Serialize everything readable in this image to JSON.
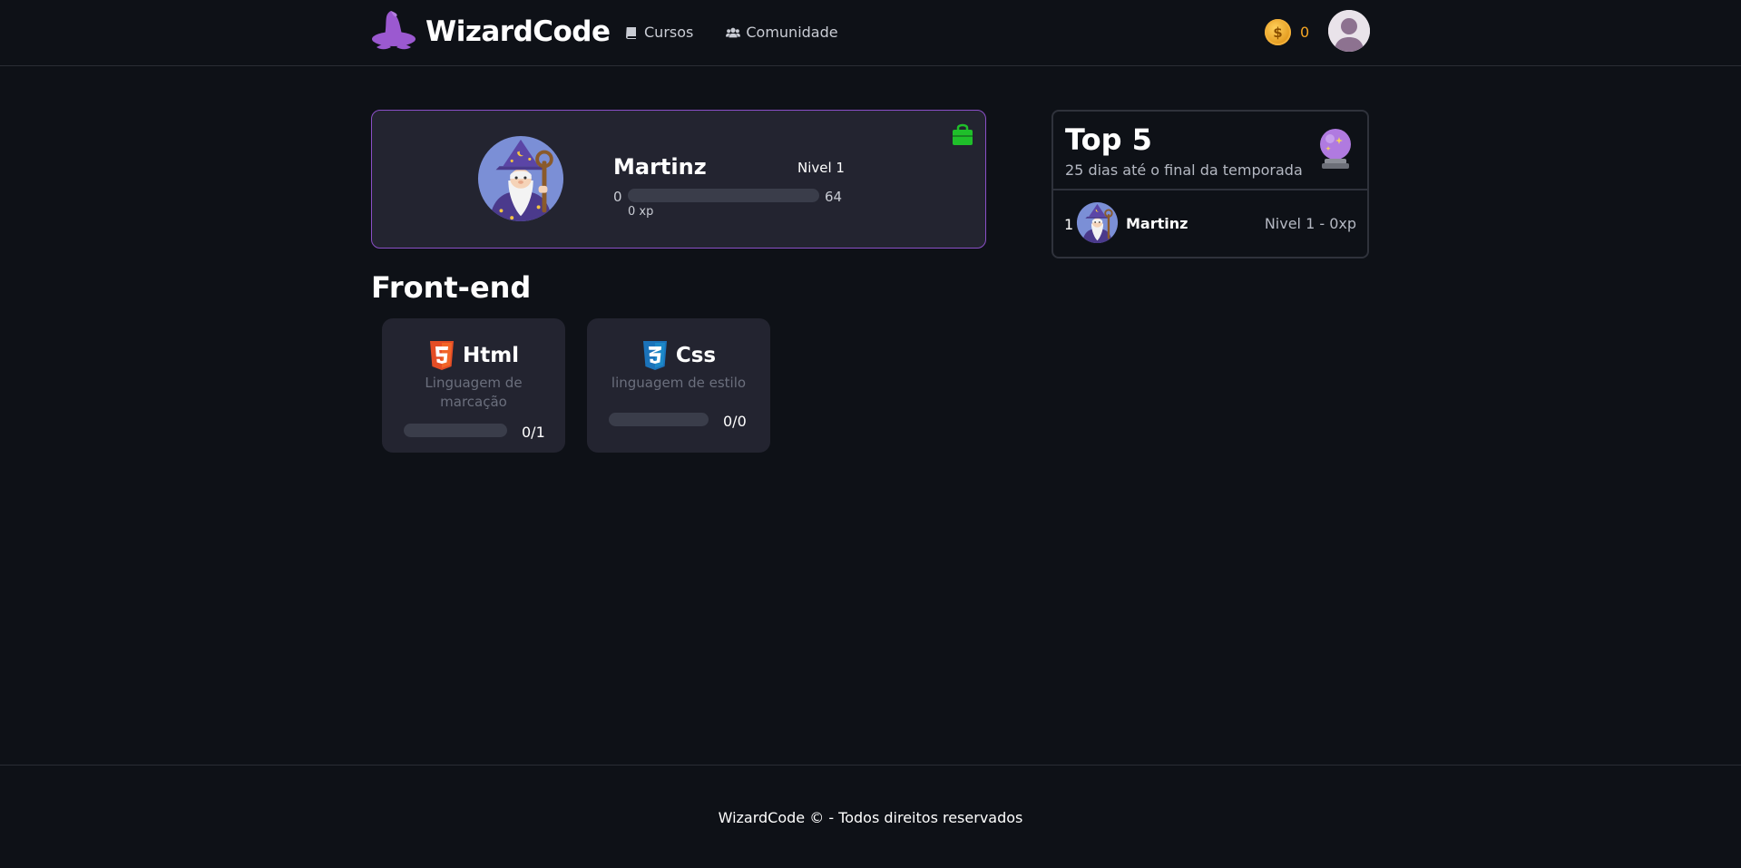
{
  "header": {
    "brand": "WizardCode",
    "nav": [
      {
        "label": "Cursos",
        "icon": "book-icon"
      },
      {
        "label": "Comunidade",
        "icon": "users-icon"
      }
    ],
    "coins": "0"
  },
  "profile": {
    "name": "Martinz",
    "level": "Nivel 1",
    "xp_min": "0",
    "xp_max": "64",
    "xp_text": "0 xp",
    "xp_progress": 0
  },
  "section": {
    "title": "Front-end"
  },
  "courses": [
    {
      "name": "Html",
      "description": "Linguagem de marcação",
      "progress": "0/1",
      "fraction": 0,
      "icon": "html5-icon"
    },
    {
      "name": "Css",
      "description": "linguagem de estilo",
      "progress": "0/0",
      "fraction": 0,
      "icon": "css3-icon"
    }
  ],
  "leaderboard": {
    "title": "Top 5",
    "subtitle": "25 dias até o final da temporada",
    "entries": [
      {
        "rank": "1",
        "name": "Martinz",
        "level": "Nivel 1 - 0xp"
      }
    ]
  },
  "footer": {
    "text": "WizardCode © - Todos direitos reservados"
  },
  "colors": {
    "background": "#0e1117",
    "card": "#232430",
    "accent": "#8a4fc7",
    "coin": "#f5a623",
    "bag": "#1fbf2a",
    "html": "#e44d26",
    "css": "#1b73ba"
  }
}
